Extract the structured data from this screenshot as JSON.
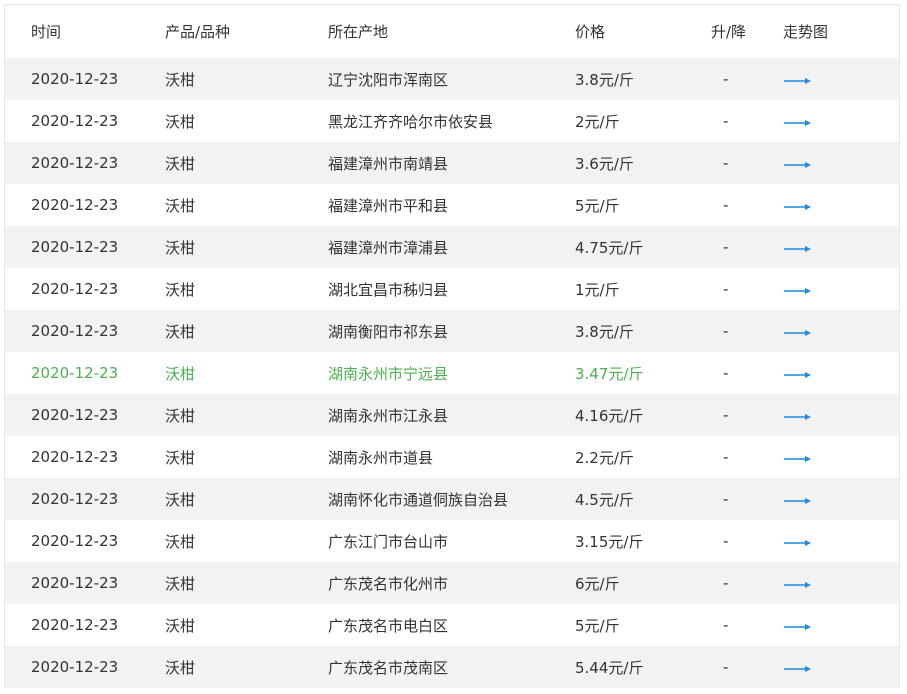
{
  "columns": {
    "date": "时间",
    "product": "产品/品种",
    "origin": "所在产地",
    "price": "价格",
    "change": "升/降",
    "trend": "走势图"
  },
  "colors": {
    "highlight_text": "#4caf50",
    "arrow": "#1e88e5",
    "alt_row_bg": "#f2f2f2"
  },
  "rows": [
    {
      "date": "2020-12-23",
      "product": "沃柑",
      "origin": "辽宁沈阳市浑南区",
      "price": "3.8元/斤",
      "change": "-",
      "trend_icon": "arrow-right-icon"
    },
    {
      "date": "2020-12-23",
      "product": "沃柑",
      "origin": "黑龙江齐齐哈尔市依安县",
      "price": "2元/斤",
      "change": "-",
      "trend_icon": "arrow-right-icon"
    },
    {
      "date": "2020-12-23",
      "product": "沃柑",
      "origin": "福建漳州市南靖县",
      "price": "3.6元/斤",
      "change": "-",
      "trend_icon": "arrow-right-icon"
    },
    {
      "date": "2020-12-23",
      "product": "沃柑",
      "origin": "福建漳州市平和县",
      "price": "5元/斤",
      "change": "-",
      "trend_icon": "arrow-right-icon"
    },
    {
      "date": "2020-12-23",
      "product": "沃柑",
      "origin": "福建漳州市漳浦县",
      "price": "4.75元/斤",
      "change": "-",
      "trend_icon": "arrow-right-icon"
    },
    {
      "date": "2020-12-23",
      "product": "沃柑",
      "origin": "湖北宜昌市秭归县",
      "price": "1元/斤",
      "change": "-",
      "trend_icon": "arrow-right-icon"
    },
    {
      "date": "2020-12-23",
      "product": "沃柑",
      "origin": "湖南衡阳市祁东县",
      "price": "3.8元/斤",
      "change": "-",
      "trend_icon": "arrow-right-icon"
    },
    {
      "date": "2020-12-23",
      "product": "沃柑",
      "origin": "湖南永州市宁远县",
      "price": "3.47元/斤",
      "change": "-",
      "trend_icon": "arrow-right-icon",
      "highlight": true
    },
    {
      "date": "2020-12-23",
      "product": "沃柑",
      "origin": "湖南永州市江永县",
      "price": "4.16元/斤",
      "change": "-",
      "trend_icon": "arrow-right-icon"
    },
    {
      "date": "2020-12-23",
      "product": "沃柑",
      "origin": "湖南永州市道县",
      "price": "2.2元/斤",
      "change": "-",
      "trend_icon": "arrow-right-icon"
    },
    {
      "date": "2020-12-23",
      "product": "沃柑",
      "origin": "湖南怀化市通道侗族自治县",
      "price": "4.5元/斤",
      "change": "-",
      "trend_icon": "arrow-right-icon"
    },
    {
      "date": "2020-12-23",
      "product": "沃柑",
      "origin": "广东江门市台山市",
      "price": "3.15元/斤",
      "change": "-",
      "trend_icon": "arrow-right-icon"
    },
    {
      "date": "2020-12-23",
      "product": "沃柑",
      "origin": "广东茂名市化州市",
      "price": "6元/斤",
      "change": "-",
      "trend_icon": "arrow-right-icon"
    },
    {
      "date": "2020-12-23",
      "product": "沃柑",
      "origin": "广东茂名市电白区",
      "price": "5元/斤",
      "change": "-",
      "trend_icon": "arrow-right-icon"
    },
    {
      "date": "2020-12-23",
      "product": "沃柑",
      "origin": "广东茂名市茂南区",
      "price": "5.44元/斤",
      "change": "-",
      "trend_icon": "arrow-right-icon"
    }
  ]
}
